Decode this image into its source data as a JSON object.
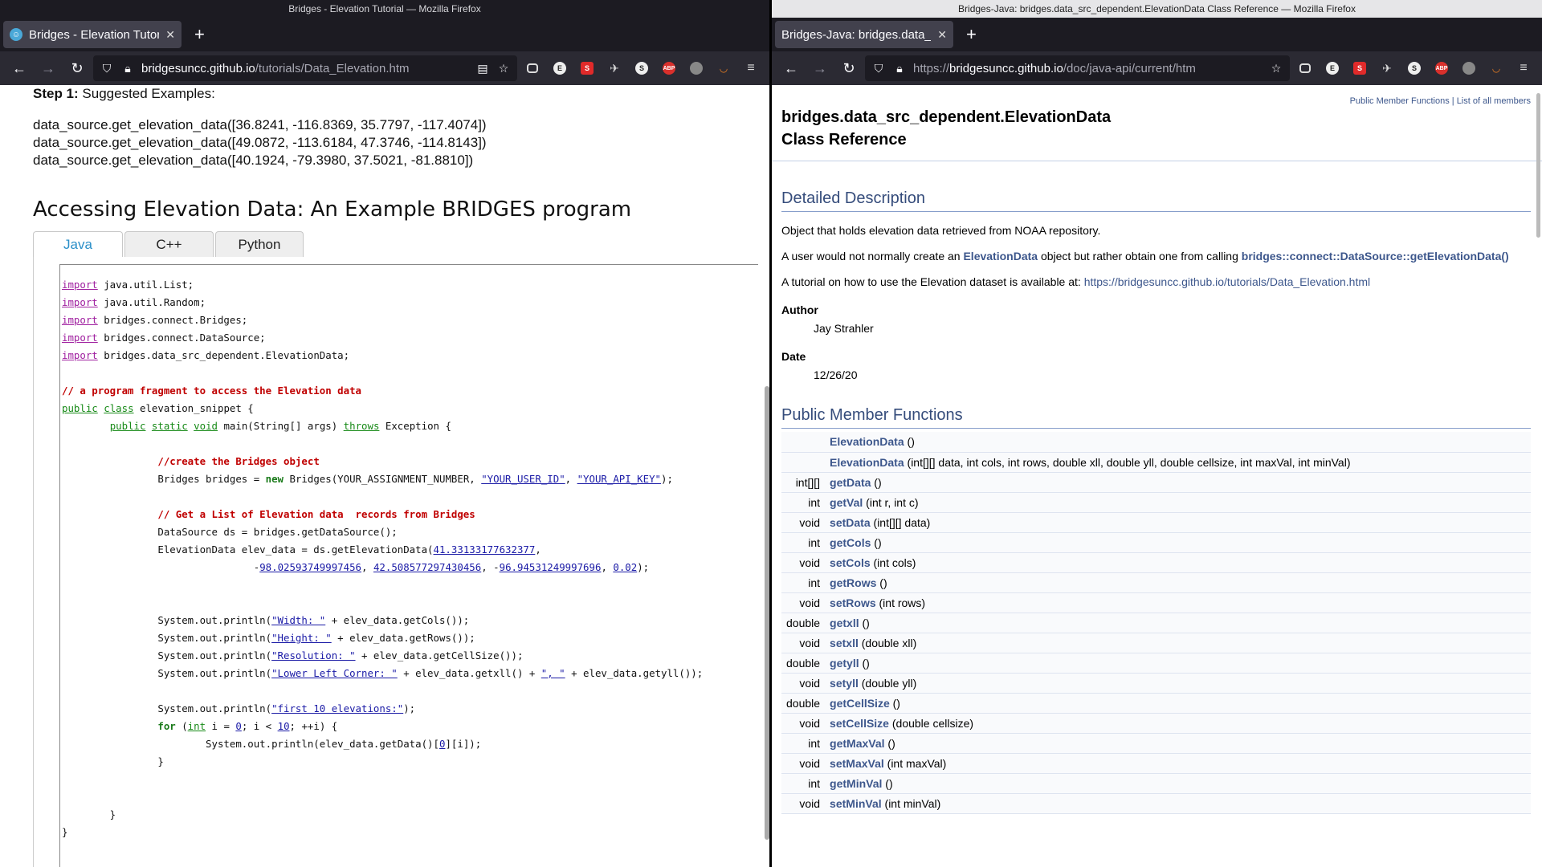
{
  "left": {
    "window_title": "Bridges - Elevation Tutorial — Mozilla Firefox",
    "tab_title": "Bridges - Elevation Tutori",
    "url_host": "bridgesuncc.github.io",
    "url_path": "/tutorials/Data_Elevation.htm",
    "step_label": "Step 1:",
    "step_text": " Suggested Examples:",
    "examples": [
      "data_source.get_elevation_data([36.8241, -116.8369, 35.7797, -117.4074])",
      "data_source.get_elevation_data([49.0872, -113.6184, 47.3746, -114.8143])",
      "data_source.get_elevation_data([40.1924, -79.3980, 37.5021, -81.8810])"
    ],
    "heading": "Accessing Elevation Data: An Example BRIDGES program",
    "code_tabs": [
      "Java",
      "C++",
      "Python"
    ],
    "active_code_tab": "Java"
  },
  "right": {
    "window_title": "Bridges-Java: bridges.data_src_dependent.ElevationData Class Reference — Mozilla Firefox",
    "tab_title": "Bridges-Java: bridges.data_s",
    "url_scheme": "https://",
    "url_host": "bridgesuncc.github.io",
    "url_path": "/doc/java-api/current/htm",
    "summary_link_1": "Public Member Functions",
    "summary_sep": " | ",
    "summary_link_2": "List of all members",
    "title_line1": "bridges.data_src_dependent.ElevationData",
    "title_line2": "Class Reference",
    "detailed_heading": "Detailed Description",
    "desc1": "Object that holds elevation data retrieved from NOAA repository.",
    "desc2_pre": "A user would not normally create an ",
    "desc2_link1": "ElevationData",
    "desc2_mid": " object but rather obtain one from calling ",
    "desc2_link2": "bridges::connect::DataSource::getElevationData()",
    "desc3_pre": "A tutorial on how to use the Elevation dataset is available at: ",
    "desc3_link": "https://bridgesuncc.github.io/tutorials/Data_Elevation.html",
    "author_label": "Author",
    "author": "Jay Strahler",
    "date_label": "Date",
    "date": "12/26/20",
    "pmf_heading": "Public Member Functions",
    "members": [
      {
        "type": "",
        "name": "ElevationData",
        "args": " ()"
      },
      {
        "type": "",
        "name": "ElevationData",
        "args": " (int[][] data, int cols, int rows, double xll, double yll, double cellsize, int maxVal, int minVal)"
      },
      {
        "type": "int[][]",
        "name": "getData",
        "args": " ()"
      },
      {
        "type": "int",
        "name": "getVal",
        "args": " (int r, int c)"
      },
      {
        "type": "void",
        "name": "setData",
        "args": " (int[][] data)"
      },
      {
        "type": "int",
        "name": "getCols",
        "args": " ()"
      },
      {
        "type": "void",
        "name": "setCols",
        "args": " (int cols)"
      },
      {
        "type": "int",
        "name": "getRows",
        "args": " ()"
      },
      {
        "type": "void",
        "name": "setRows",
        "args": " (int rows)"
      },
      {
        "type": "double",
        "name": "getxll",
        "args": " ()"
      },
      {
        "type": "void",
        "name": "setxll",
        "args": " (double xll)"
      },
      {
        "type": "double",
        "name": "getyll",
        "args": " ()"
      },
      {
        "type": "void",
        "name": "setyll",
        "args": " (double yll)"
      },
      {
        "type": "double",
        "name": "getCellSize",
        "args": " ()"
      },
      {
        "type": "void",
        "name": "setCellSize",
        "args": " (double cellsize)"
      },
      {
        "type": "int",
        "name": "getMaxVal",
        "args": " ()"
      },
      {
        "type": "void",
        "name": "setMaxVal",
        "args": " (int maxVal)"
      },
      {
        "type": "int",
        "name": "getMinVal",
        "args": " ()"
      },
      {
        "type": "void",
        "name": "setMinVal",
        "args": " (int minVal)"
      }
    ]
  },
  "code_lines": [
    [
      [
        "kw",
        "import"
      ],
      [
        "t",
        " java.util.List;"
      ]
    ],
    [
      [
        "kw",
        "import"
      ],
      [
        "t",
        " java.util.Random;"
      ]
    ],
    [
      [
        "kw",
        "import"
      ],
      [
        "t",
        " bridges.connect.Bridges;"
      ]
    ],
    [
      [
        "kw",
        "import"
      ],
      [
        "t",
        " bridges.connect.DataSource;"
      ]
    ],
    [
      [
        "kw",
        "import"
      ],
      [
        "t",
        " bridges.data_src_dependent.ElevationData;"
      ]
    ],
    [],
    [
      [
        "cm",
        "// a program fragment to access the Elevation data"
      ]
    ],
    [
      [
        "kg",
        "public"
      ],
      [
        "t",
        " "
      ],
      [
        "kg",
        "class"
      ],
      [
        "t",
        " elevation_snippet {"
      ]
    ],
    [
      [
        "t",
        "        "
      ],
      [
        "kg",
        "public"
      ],
      [
        "t",
        " "
      ],
      [
        "kg",
        "static"
      ],
      [
        "t",
        " "
      ],
      [
        "kg",
        "void"
      ],
      [
        "t",
        " main(String[] args) "
      ],
      [
        "kg",
        "throws"
      ],
      [
        "t",
        " Exception {"
      ]
    ],
    [],
    [
      [
        "t",
        "                "
      ],
      [
        "cm",
        "//create the Bridges object"
      ]
    ],
    [
      [
        "t",
        "                Bridges bridges = "
      ],
      [
        "kn",
        "new"
      ],
      [
        "t",
        " Bridges(YOUR_ASSIGNMENT_NUMBER, "
      ],
      [
        "st",
        "\"YOUR_USER_ID\""
      ],
      [
        "t",
        ", "
      ],
      [
        "st",
        "\"YOUR_API_KEY\""
      ],
      [
        "t",
        ");"
      ]
    ],
    [],
    [
      [
        "t",
        "                "
      ],
      [
        "cm",
        "// Get a List of Elevation data  records from Bridges"
      ]
    ],
    [
      [
        "t",
        "                DataSource ds = bridges.getDataSource();"
      ]
    ],
    [
      [
        "t",
        "                ElevationData elev_data = ds.getElevationData("
      ],
      [
        "nm",
        "41.33133177632377"
      ],
      [
        "t",
        ","
      ]
    ],
    [
      [
        "t",
        "                                -"
      ],
      [
        "nm",
        "98.02593749997456"
      ],
      [
        "t",
        ", "
      ],
      [
        "nm",
        "42.508577297430456"
      ],
      [
        "t",
        ", -"
      ],
      [
        "nm",
        "96.94531249997696"
      ],
      [
        "t",
        ", "
      ],
      [
        "nm",
        "0.02"
      ],
      [
        "t",
        ");"
      ]
    ],
    [],
    [],
    [
      [
        "t",
        "                System.out.println("
      ],
      [
        "st",
        "\"Width: \""
      ],
      [
        "t",
        " + elev_data.getCols());"
      ]
    ],
    [
      [
        "t",
        "                System.out.println("
      ],
      [
        "st",
        "\"Height: \""
      ],
      [
        "t",
        " + elev_data.getRows());"
      ]
    ],
    [
      [
        "t",
        "                System.out.println("
      ],
      [
        "st",
        "\"Resolution: \""
      ],
      [
        "t",
        " + elev_data.getCellSize());"
      ]
    ],
    [
      [
        "t",
        "                System.out.println("
      ],
      [
        "st",
        "\"Lower Left Corner: \""
      ],
      [
        "t",
        " + elev_data.getxll() + "
      ],
      [
        "st",
        "\", \""
      ],
      [
        "t",
        " + elev_data.getyll());"
      ]
    ],
    [],
    [
      [
        "t",
        "                System.out.println("
      ],
      [
        "st",
        "\"first 10 elevations:\""
      ],
      [
        "t",
        ");"
      ]
    ],
    [
      [
        "t",
        "                "
      ],
      [
        "kn",
        "for"
      ],
      [
        "t",
        " ("
      ],
      [
        "kg",
        "int"
      ],
      [
        "t",
        " i = "
      ],
      [
        "nm",
        "0"
      ],
      [
        "t",
        "; i < "
      ],
      [
        "nm",
        "10"
      ],
      [
        "t",
        "; ++i) {"
      ]
    ],
    [
      [
        "t",
        "                        System.out.println(elev_data.getData()["
      ],
      [
        "nm",
        "0"
      ],
      [
        "t",
        "][i]);"
      ]
    ],
    [
      [
        "t",
        "                }"
      ]
    ],
    [],
    [],
    [
      [
        "t",
        "        }"
      ]
    ],
    [
      [
        "t",
        "}"
      ]
    ]
  ]
}
